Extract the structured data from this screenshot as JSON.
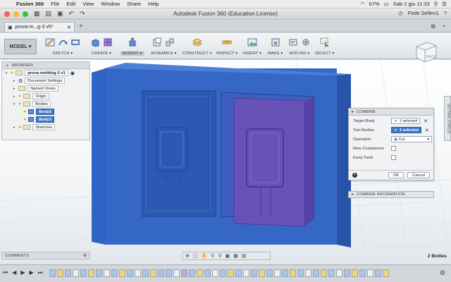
{
  "menubar": {
    "app": "Fusion 360",
    "items": [
      "File",
      "Edit",
      "View",
      "Window",
      "Share",
      "Help"
    ],
    "battery": "67%",
    "datetime": "Sab 2 giu  11:33"
  },
  "window": {
    "title": "Autodesk Fusion 360 (Education License)",
    "user": "Fede Sellen1"
  },
  "doc_tab": {
    "name": "prova-m...g-3 v5*"
  },
  "ribbon": {
    "workspace": "MODEL",
    "groups": [
      {
        "label": "SKETCH ▾"
      },
      {
        "label": "CREATE ▾"
      },
      {
        "label": "MODIFY ▾"
      },
      {
        "label": "ASSEMBLE ▾"
      },
      {
        "label": "CONSTRUCT ▾"
      },
      {
        "label": "INSPECT ▾"
      },
      {
        "label": "INSERT ▾"
      },
      {
        "label": "MAKE ▾"
      },
      {
        "label": "ADD-INS ▾"
      },
      {
        "label": "SELECT ▾"
      }
    ]
  },
  "browser": {
    "header": "BROWSER",
    "root": "prova-molding-3 v1",
    "items": [
      "Document Settings",
      "Named Views",
      "Origin",
      "Bodies",
      "Body2",
      "Body3",
      "Sketches"
    ]
  },
  "comments": {
    "label": "COMMENTS"
  },
  "combine": {
    "title": "COMBINE",
    "target_body_label": "Target Body",
    "target_body_value": "1 selected",
    "tool_bodies_label": "Tool Bodies",
    "tool_bodies_value": "1 selected",
    "operation_label": "Operation",
    "operation_value": "Cut",
    "new_component_label": "New Component",
    "keep_tools_label": "Keep Tools",
    "ok": "OK",
    "cancel": "Cancel"
  },
  "combine_info": {
    "label": "COMBINE INFORMATION"
  },
  "viewcube": {
    "label": "BACK"
  },
  "side_tab": {
    "label": "SETTING STATUS"
  },
  "status": {
    "body_count": "2 Bodies"
  },
  "colors": {
    "body_blue": "#2f66c8",
    "cavity_purple": "#6a52b8",
    "select_blue": "#3d79c4"
  }
}
